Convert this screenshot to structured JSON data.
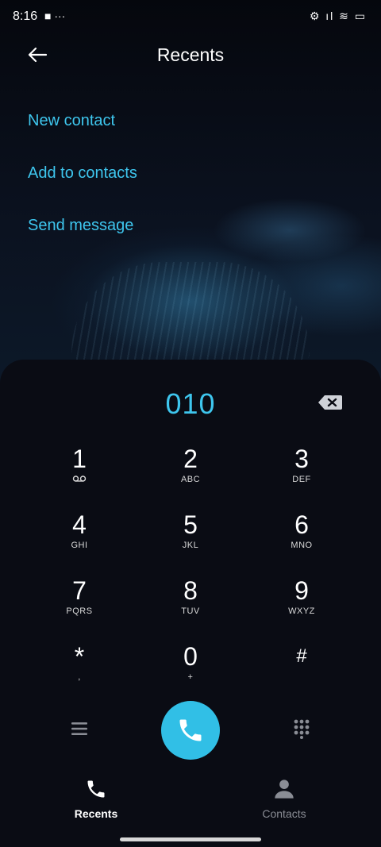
{
  "status_bar": {
    "time": "8:16"
  },
  "header": {
    "title": "Recents"
  },
  "menu": {
    "new_contact": "New contact",
    "add_to_contacts": "Add to contacts",
    "send_message": "Send message"
  },
  "dialer": {
    "number": "010",
    "keys": [
      {
        "digit": "1",
        "letters": ""
      },
      {
        "digit": "2",
        "letters": "ABC"
      },
      {
        "digit": "3",
        "letters": "DEF"
      },
      {
        "digit": "4",
        "letters": "GHI"
      },
      {
        "digit": "5",
        "letters": "JKL"
      },
      {
        "digit": "6",
        "letters": "MNO"
      },
      {
        "digit": "7",
        "letters": "PQRS"
      },
      {
        "digit": "8",
        "letters": "TUV"
      },
      {
        "digit": "9",
        "letters": "WXYZ"
      },
      {
        "digit": "*",
        "letters": ","
      },
      {
        "digit": "0",
        "letters": "+"
      },
      {
        "digit": "#",
        "letters": ""
      }
    ]
  },
  "nav": {
    "recents": "Recents",
    "contacts": "Contacts"
  },
  "colors": {
    "accent": "#3ec6ee",
    "call_button": "#31bfe6",
    "background": "#0a0c14"
  },
  "icons": {
    "back": "back-arrow-icon",
    "backspace": "backspace-icon",
    "voicemail": "voicemail-icon",
    "menu": "menu-icon",
    "call": "phone-icon",
    "keypad": "keypad-icon",
    "recents": "phone-icon",
    "contacts": "person-icon"
  }
}
